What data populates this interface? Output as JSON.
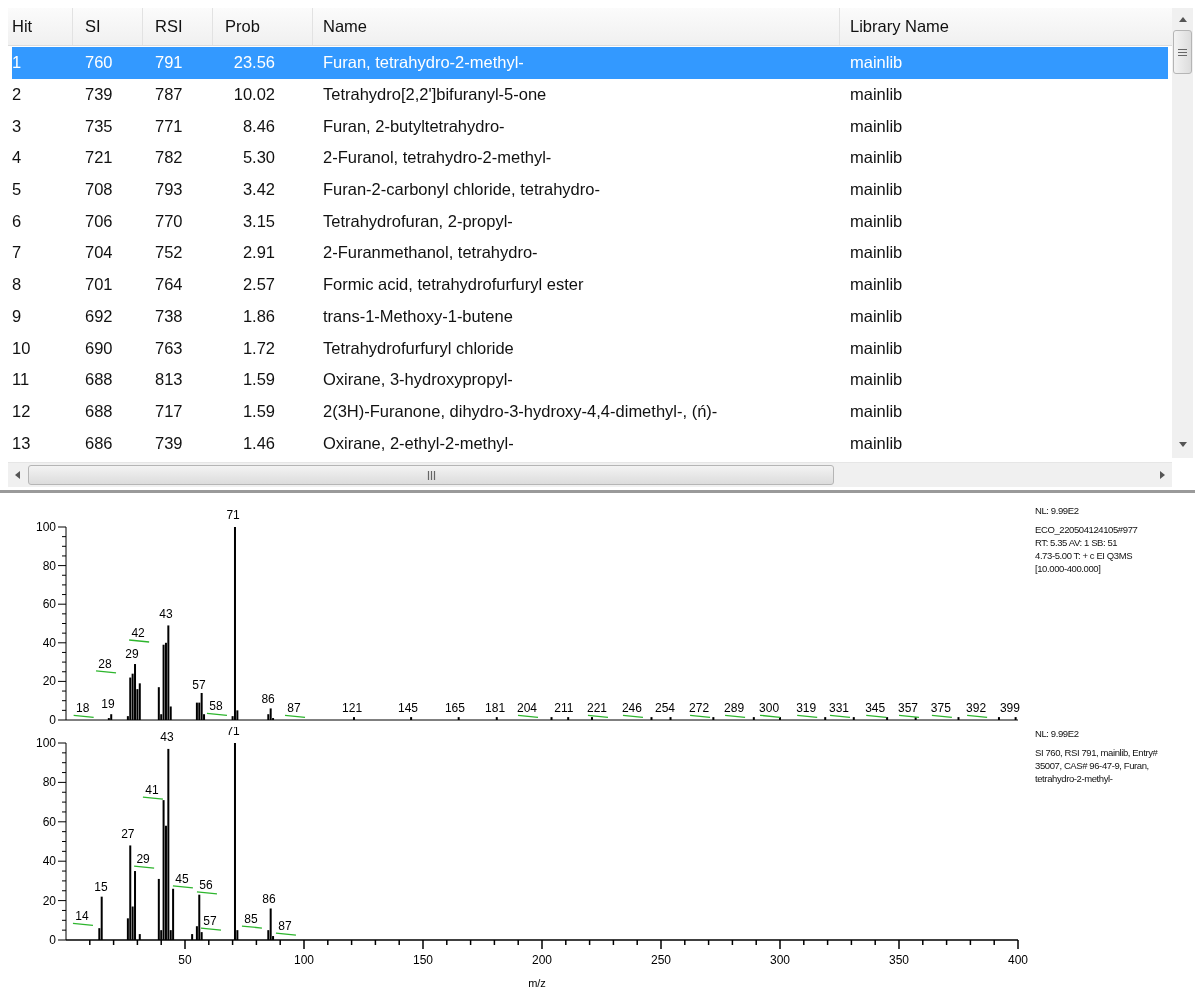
{
  "table": {
    "columns": [
      "Hit",
      "SI",
      "RSI",
      "Prob",
      "Name",
      "Library Name"
    ],
    "rows": [
      {
        "cells": [
          "1",
          "760",
          "791",
          "23.56",
          "Furan, tetrahydro-2-methyl-",
          "mainlib"
        ],
        "selected": true
      },
      {
        "cells": [
          "2",
          "739",
          "787",
          "10.02",
          "Tetrahydro[2,2']bifuranyl-5-one",
          "mainlib"
        ],
        "selected": false
      },
      {
        "cells": [
          "3",
          "735",
          "771",
          "8.46",
          "Furan, 2-butyltetrahydro-",
          "mainlib"
        ],
        "selected": false
      },
      {
        "cells": [
          "4",
          "721",
          "782",
          "5.30",
          "2-Furanol, tetrahydro-2-methyl-",
          "mainlib"
        ],
        "selected": false
      },
      {
        "cells": [
          "5",
          "708",
          "793",
          "3.42",
          "Furan-2-carbonyl chloride, tetrahydro-",
          "mainlib"
        ],
        "selected": false
      },
      {
        "cells": [
          "6",
          "706",
          "770",
          "3.15",
          "Tetrahydrofuran, 2-propyl-",
          "mainlib"
        ],
        "selected": false
      },
      {
        "cells": [
          "7",
          "704",
          "752",
          "2.91",
          "2-Furanmethanol, tetrahydro-",
          "mainlib"
        ],
        "selected": false
      },
      {
        "cells": [
          "8",
          "701",
          "764",
          "2.57",
          "Formic acid, tetrahydrofurfuryl ester",
          "mainlib"
        ],
        "selected": false
      },
      {
        "cells": [
          "9",
          "692",
          "738",
          "1.86",
          "trans-1-Methoxy-1-butene",
          "mainlib"
        ],
        "selected": false
      },
      {
        "cells": [
          "10",
          "690",
          "763",
          "1.72",
          "Tetrahydrofurfuryl chloride",
          "mainlib"
        ],
        "selected": false
      },
      {
        "cells": [
          "11",
          "688",
          "813",
          "1.59",
          "Oxirane, 3-hydroxypropyl-",
          "mainlib"
        ],
        "selected": false
      },
      {
        "cells": [
          "12",
          "688",
          "717",
          "1.59",
          "2(3H)-Furanone, dihydro-3-hydroxy-4,4-dimethyl-, (ń)-",
          "mainlib"
        ],
        "selected": false
      },
      {
        "cells": [
          "13",
          "686",
          "739",
          "1.46",
          "Oxirane, 2-ethyl-2-methyl-",
          "mainlib"
        ],
        "selected": false
      }
    ]
  },
  "spectra": [
    {
      "info": [
        "NL: 9.99E2",
        "ECO_220504124105#977",
        "RT: 5.35  AV: 1 SB: 51",
        "4.73-5.00 T: + c EI Q3MS",
        "[10.000-400.000]"
      ],
      "chart_data": {
        "type": "bar",
        "xlim": [
          0,
          400
        ],
        "ylim": [
          0,
          100
        ],
        "yticks": [
          0,
          20,
          40,
          60,
          80,
          100
        ],
        "x": [
          18,
          19,
          26,
          27,
          28,
          29,
          30,
          31,
          39,
          40,
          41,
          42,
          43,
          44,
          55,
          56,
          57,
          58,
          70,
          71,
          72,
          85,
          86,
          87,
          121,
          145,
          165,
          181,
          204,
          211,
          221,
          246,
          254,
          272,
          289,
          300,
          319,
          331,
          345,
          357,
          375,
          392,
          399
        ],
        "series": [
          {
            "color": "#000000",
            "values": [
              1,
              3,
              2,
              22,
              24,
              29,
              16,
              19,
              17,
              3,
              39,
              40,
              49,
              7,
              9,
              9,
              14,
              3,
              2,
              100,
              5,
              3,
              6,
              1,
              1.5,
              1.5,
              1.5,
              1.5,
              1.5,
              1.5,
              1.5,
              1.5,
              1.5,
              1.5,
              1.5,
              1.5,
              1.5,
              1.5,
              1.5,
              1.5,
              1.5,
              1.5,
              1.5
            ]
          }
        ]
      },
      "peak_labels": [
        {
          "text": "18",
          "leader": true
        },
        {
          "text": "19",
          "leader": false
        },
        {
          "text": "28",
          "leader": true
        },
        {
          "text": "29",
          "leader": false
        },
        {
          "text": "42",
          "leader": true
        },
        {
          "text": "43",
          "leader": false
        },
        {
          "text": "57",
          "leader": false
        },
        {
          "text": "58",
          "leader": true
        },
        {
          "text": "71",
          "leader": false
        },
        {
          "text": "86",
          "leader": false
        },
        {
          "text": "87",
          "leader": true
        },
        {
          "text": "121",
          "leader": false
        },
        {
          "text": "145",
          "leader": false
        },
        {
          "text": "165",
          "leader": false
        },
        {
          "text": "181",
          "leader": false
        },
        {
          "text": "204",
          "leader": true
        },
        {
          "text": "211",
          "leader": false
        },
        {
          "text": "221",
          "leader": true
        },
        {
          "text": "246",
          "leader": true
        },
        {
          "text": "254",
          "leader": false
        },
        {
          "text": "272",
          "leader": true
        },
        {
          "text": "289",
          "leader": true
        },
        {
          "text": "300",
          "leader": true
        },
        {
          "text": "319",
          "leader": true
        },
        {
          "text": "331",
          "leader": true
        },
        {
          "text": "345",
          "leader": true
        },
        {
          "text": "357",
          "leader": true
        },
        {
          "text": "375",
          "leader": true
        },
        {
          "text": "392",
          "leader": true
        },
        {
          "text": "399",
          "leader": false
        }
      ]
    },
    {
      "info": [
        "NL: 9.99E2",
        "SI 760, RSI 791, mainlib, Entry# 35007, CAS# 96-47-9, Furan, tetrahydro-2-methyl-"
      ],
      "chart_data": {
        "type": "bar",
        "xlabel": "m/z",
        "xlim": [
          0,
          400
        ],
        "ylim": [
          0,
          100
        ],
        "yticks": [
          0,
          20,
          40,
          60,
          80,
          100
        ],
        "xticks": [
          50,
          100,
          150,
          200,
          250,
          300,
          350,
          400
        ],
        "x": [
          14,
          15,
          26,
          27,
          28,
          29,
          31,
          39,
          40,
          41,
          42,
          43,
          44,
          45,
          53,
          55,
          56,
          57,
          71,
          72,
          85,
          86,
          87
        ],
        "series": [
          {
            "color": "#000000",
            "values": [
              6,
              22,
              11,
              48,
              17,
              35,
              3,
              31,
              5,
              71,
              58,
              97,
              5,
              26,
              3,
              7,
              23,
              4,
              100,
              5,
              5,
              16,
              2
            ]
          }
        ]
      },
      "peak_labels": [
        {
          "text": "14",
          "leader": true
        },
        {
          "text": "15",
          "leader": false
        },
        {
          "text": "27",
          "leader": false
        },
        {
          "text": "29",
          "leader": true
        },
        {
          "text": "41",
          "leader": true
        },
        {
          "text": "43",
          "leader": false
        },
        {
          "text": "45",
          "leader": true
        },
        {
          "text": "56",
          "leader": true
        },
        {
          "text": "57",
          "leader": true
        },
        {
          "text": "71",
          "leader": false
        },
        {
          "text": "85",
          "leader": true
        },
        {
          "text": "86",
          "leader": false
        },
        {
          "text": "87",
          "leader": true
        }
      ]
    }
  ]
}
